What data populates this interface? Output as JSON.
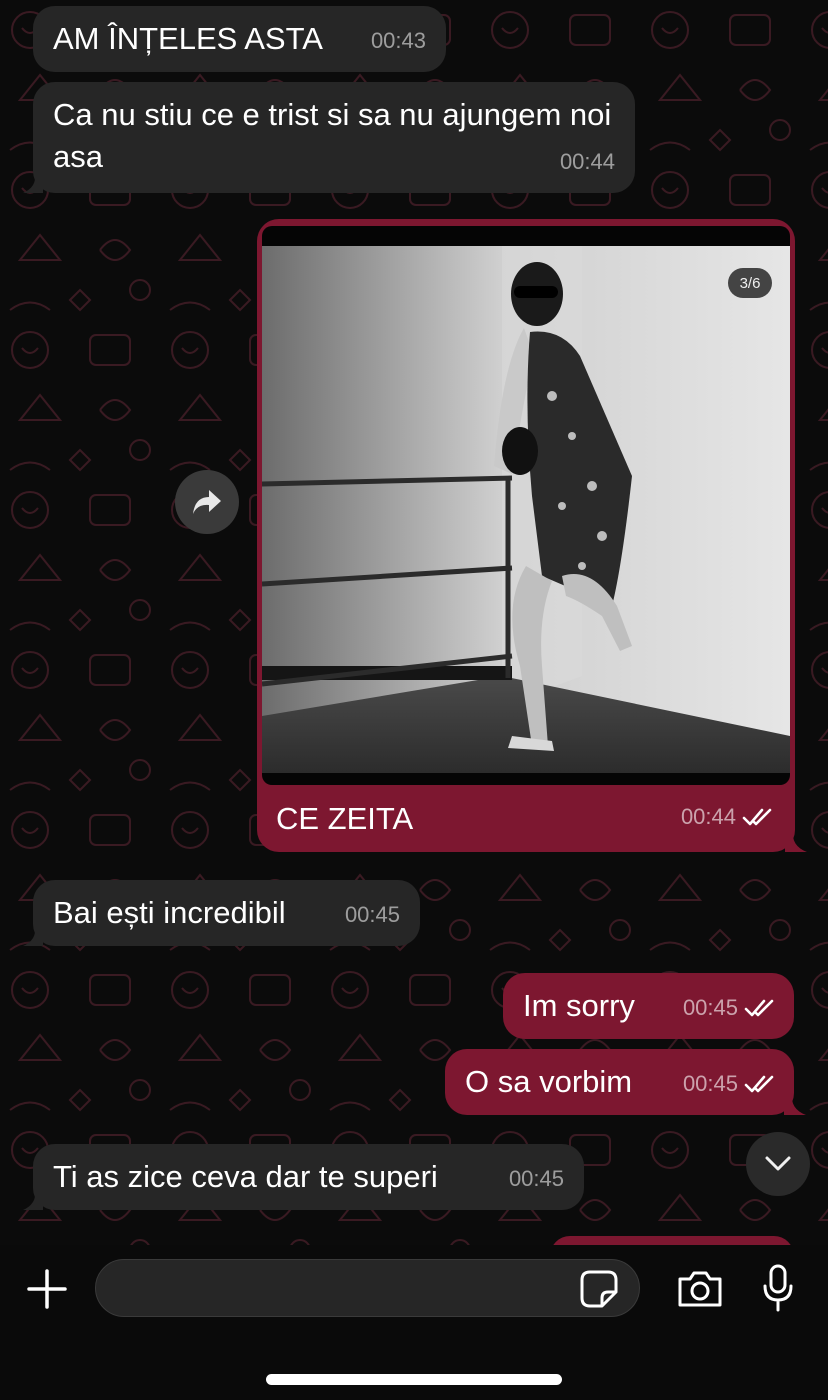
{
  "colors": {
    "incoming_bubble": "#262626",
    "outgoing_bubble": "#7d1730",
    "background": "#0b0b0b",
    "wallpaper_pattern": "#3a1a22"
  },
  "messages": [
    {
      "direction": "in",
      "text": "AM ÎNȚELES ASTA",
      "time": "00:43"
    },
    {
      "direction": "in",
      "text": "Ca nu stiu ce e trist si sa nu ajungem noi asa",
      "time": "00:44"
    },
    {
      "direction": "out",
      "type": "image",
      "image_counter": "3/6",
      "caption": "CE ZEITA",
      "time": "00:44",
      "status": "read"
    },
    {
      "direction": "in",
      "text": "Bai ești incredibil",
      "time": "00:45"
    },
    {
      "direction": "out",
      "text": "Im sorry",
      "time": "00:45",
      "status": "read"
    },
    {
      "direction": "out",
      "text": "O sa vorbim",
      "time": "00:45",
      "status": "read"
    },
    {
      "direction": "in",
      "text": "Ti as zice ceva dar te superi",
      "time": "00:45"
    }
  ],
  "composer": {
    "value": "",
    "placeholder": "",
    "icons": [
      "plus-icon",
      "sticker-icon",
      "camera-icon",
      "microphone-icon"
    ]
  },
  "floating": {
    "share_icon": "share-arrow-icon",
    "scroll_icon": "chevron-down-icon"
  }
}
